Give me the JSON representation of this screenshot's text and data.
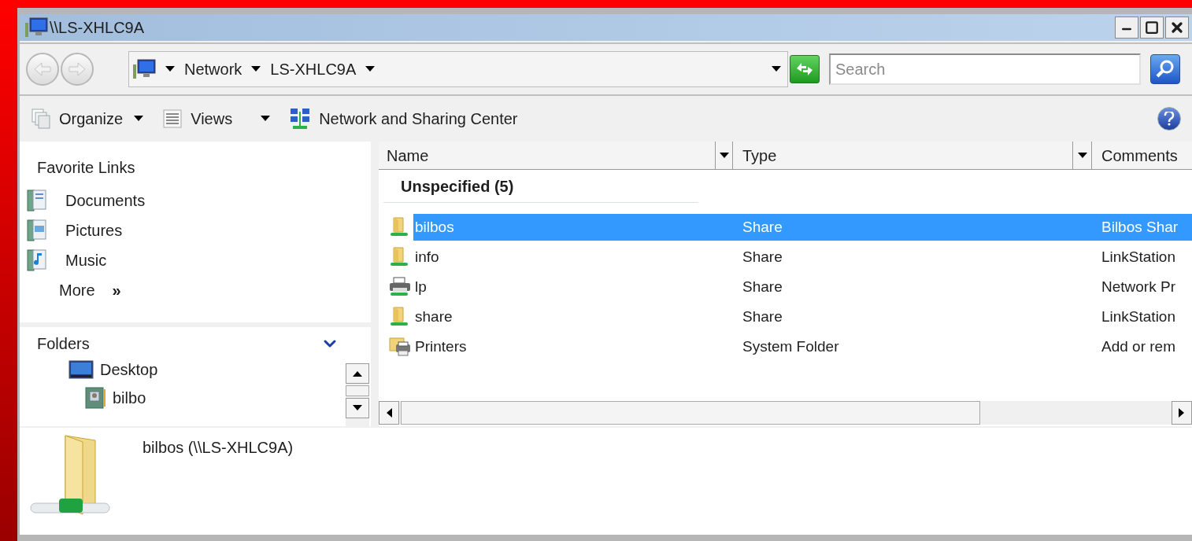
{
  "window": {
    "title": "\\\\LS-XHLC9A"
  },
  "address": {
    "crumbs": [
      "Network",
      "LS-XHLC9A"
    ]
  },
  "search": {
    "placeholder": "Search"
  },
  "toolbar": [
    {
      "label": "Organize",
      "kind": "organize"
    },
    {
      "label": "Views",
      "kind": "views"
    },
    {
      "label": "Network and Sharing Center",
      "kind": "network"
    }
  ],
  "favorite_links": {
    "title": "Favorite Links",
    "items": [
      {
        "label": "Documents",
        "kind": "documents"
      },
      {
        "label": "Pictures",
        "kind": "pictures"
      },
      {
        "label": "Music",
        "kind": "music"
      }
    ],
    "more": {
      "label": "More",
      "chevron": "»"
    }
  },
  "folders": {
    "title": "Folders",
    "tree": [
      {
        "label": "Desktop",
        "kind": "desktop",
        "children": [
          {
            "label": "bilbo",
            "kind": "user"
          }
        ]
      }
    ]
  },
  "list": {
    "columns": [
      "Name",
      "Type",
      "Comments"
    ],
    "group": "Unspecified (5)",
    "rows": [
      {
        "name": "bilbos",
        "type": "Share",
        "comments": "Bilbos Shar",
        "kind": "share",
        "selected": true
      },
      {
        "name": "info",
        "type": "Share",
        "comments": "LinkStation",
        "kind": "share",
        "selected": false
      },
      {
        "name": "lp",
        "type": "Share",
        "comments": "Network Pr",
        "kind": "printer",
        "selected": false
      },
      {
        "name": "share",
        "type": "Share",
        "comments": "LinkStation",
        "kind": "share",
        "selected": false
      },
      {
        "name": "Printers",
        "type": "System Folder",
        "comments": "Add or rem",
        "kind": "printers",
        "selected": false
      }
    ]
  },
  "details": {
    "title": "bilbos (\\\\LS-XHLC9A)"
  }
}
